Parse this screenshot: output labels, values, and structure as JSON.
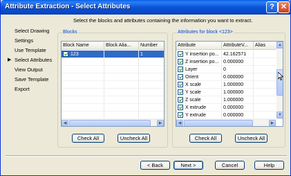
{
  "window": {
    "title": "Attribute Extraction - Select Attributes",
    "help_glyph": "?",
    "close_glyph": "✕"
  },
  "instruction": "Select the blocks and attributes containing the information you want to extract.",
  "nav": {
    "items": [
      {
        "label": "Select Drawing",
        "current": false
      },
      {
        "label": "Settings",
        "current": false
      },
      {
        "label": "Use Template",
        "current": false
      },
      {
        "label": "Select Attributes",
        "current": true
      },
      {
        "label": "View Output",
        "current": false
      },
      {
        "label": "Save Template",
        "current": false
      },
      {
        "label": "Export",
        "current": false
      }
    ],
    "current_marker": "▶"
  },
  "blocks": {
    "group_label": "Blocks",
    "columns": [
      "Block Name",
      "Block Alia...",
      "Number"
    ],
    "rows": [
      {
        "checked": true,
        "name": "123",
        "alias": "",
        "number": "1"
      }
    ],
    "check_all": "Check All",
    "uncheck_all": "Uncheck All"
  },
  "attributes": {
    "group_label": "Attributes for block <123>",
    "columns": [
      "Attribute",
      "AttributeV...",
      "Alias"
    ],
    "rows": [
      {
        "checked": true,
        "name": "Y insertion po...",
        "value": "42.162571"
      },
      {
        "checked": true,
        "name": "Z insertion po...",
        "value": "0.000000"
      },
      {
        "checked": true,
        "name": "Layer",
        "value": "0"
      },
      {
        "checked": true,
        "name": "Orient",
        "value": "0.000000"
      },
      {
        "checked": true,
        "name": "X scale",
        "value": "1.000000"
      },
      {
        "checked": true,
        "name": "Y scale",
        "value": "1.000000"
      },
      {
        "checked": true,
        "name": "Z scale",
        "value": "1.000000"
      },
      {
        "checked": true,
        "name": "X extrude",
        "value": "0.000000"
      },
      {
        "checked": true,
        "name": "Y extrude",
        "value": "0.000000"
      }
    ],
    "check_all": "Check All",
    "uncheck_all": "Uncheck All"
  },
  "footer": {
    "back": "< Back",
    "next": "Next >",
    "cancel": "Cancel",
    "help": "Help"
  },
  "colors": {
    "title_bar": "#0A54D8",
    "selection": "#316AC5",
    "group_label": "#0046D5",
    "dialog_bg": "#ECE9D8"
  }
}
